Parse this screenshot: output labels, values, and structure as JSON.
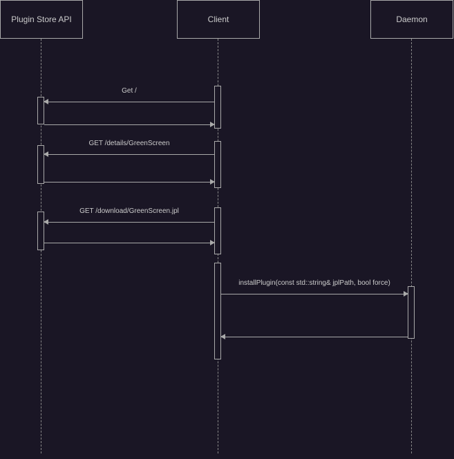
{
  "participants": {
    "p0": "Plugin Store API",
    "p1": "Client",
    "p2": "Daemon"
  },
  "messages": {
    "m0": "Get /",
    "m1": "GET /details/GreenScreen",
    "m2": "GET /download/GreenScreen.jpl",
    "m3": "installPlugin(const std::string& jplPath, bool force)"
  },
  "chart_data": {
    "type": "sequence-diagram",
    "participants": [
      "Plugin Store API",
      "Client",
      "Daemon"
    ],
    "interactions": [
      {
        "from": "Client",
        "to": "Plugin Store API",
        "message": "Get /",
        "return": true
      },
      {
        "from": "Client",
        "to": "Plugin Store API",
        "message": "GET /details/GreenScreen",
        "return": true
      },
      {
        "from": "Client",
        "to": "Plugin Store API",
        "message": "GET /download/GreenScreen.jpl",
        "return": true
      },
      {
        "from": "Client",
        "to": "Daemon",
        "message": "installPlugin(const std::string& jplPath, bool force)",
        "return": true
      }
    ]
  }
}
